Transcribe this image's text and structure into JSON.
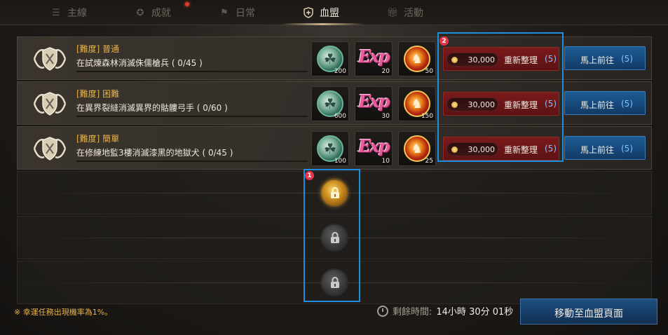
{
  "tabs": [
    {
      "label": "主線",
      "icon": "list-icon"
    },
    {
      "label": "成就",
      "icon": "medal-icon"
    },
    {
      "label": "日常",
      "icon": "flag-icon"
    },
    {
      "label": "血盟",
      "icon": "guild-shield-icon",
      "active": true
    },
    {
      "label": "活動",
      "icon": "gift-icon"
    }
  ],
  "missions": [
    {
      "difficulty": "[難度] 普通",
      "description": "在試煉森林消滅侏儒槍兵 ( 0/45 )",
      "rewards": [
        {
          "icon": "guild-coin-icon",
          "count": "200"
        },
        {
          "icon": "exp-icon",
          "count": "20"
        },
        {
          "icon": "contribution-coin-icon",
          "count": "50"
        }
      ],
      "refresh_cost": "30,000",
      "refresh_label": "重新整理",
      "refresh_count": "(5)",
      "goto_label": "馬上前往",
      "goto_count": "(5)"
    },
    {
      "difficulty": "[難度] 困難",
      "description": "在異界裂縫消滅異界的骷髏弓手 ( 0/60 )",
      "rewards": [
        {
          "icon": "guild-coin-icon",
          "count": "600"
        },
        {
          "icon": "exp-icon",
          "count": "30"
        },
        {
          "icon": "contribution-coin-icon",
          "count": "150"
        }
      ],
      "refresh_cost": "30,000",
      "refresh_label": "重新整理",
      "refresh_count": "(5)",
      "goto_label": "馬上前往",
      "goto_count": "(5)"
    },
    {
      "difficulty": "[難度] 簡單",
      "description": "在修練地監3樓消滅漆黑的地獄犬 ( 0/45 )",
      "rewards": [
        {
          "icon": "guild-coin-icon",
          "count": "100"
        },
        {
          "icon": "exp-icon",
          "count": "10"
        },
        {
          "icon": "contribution-coin-icon",
          "count": "25"
        }
      ],
      "refresh_cost": "30,000",
      "refresh_label": "重新整理",
      "refresh_count": "(5)",
      "goto_label": "馬上前往",
      "goto_count": "(5)"
    }
  ],
  "reward_exp_text": "Exp",
  "locked_slots": [
    {
      "state": "gold"
    },
    {
      "state": "grey"
    },
    {
      "state": "grey"
    }
  ],
  "badges": {
    "locks": "1",
    "refresh": "2"
  },
  "footer": {
    "note": "※ 幸運任務出現機率為1%。",
    "timer_label": "剩餘時間:",
    "timer_value": "14小時 30分 01秒",
    "guild_button": "移動至血盟頁面"
  },
  "colors": {
    "highlight": "#1d8fe0",
    "difficulty": "#e7b24a",
    "count_blue": "#7fc1ff"
  }
}
